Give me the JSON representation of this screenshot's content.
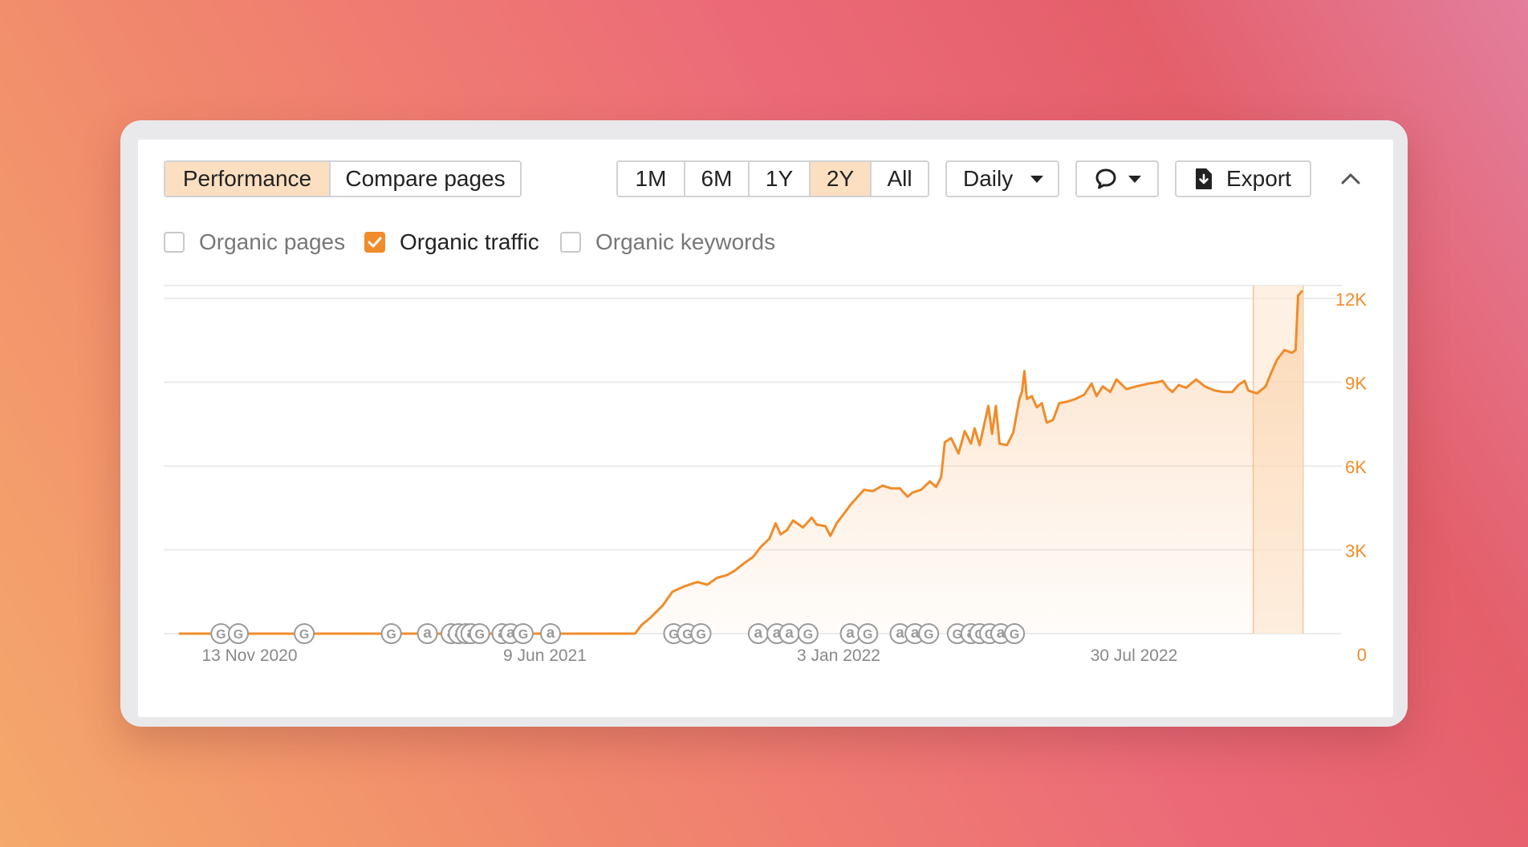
{
  "tabs": [
    {
      "label": "Performance",
      "active": true
    },
    {
      "label": "Compare pages",
      "active": false
    }
  ],
  "ranges": [
    {
      "label": "1M",
      "active": false
    },
    {
      "label": "6M",
      "active": false
    },
    {
      "label": "1Y",
      "active": false
    },
    {
      "label": "2Y",
      "active": true
    },
    {
      "label": "All",
      "active": false
    }
  ],
  "interval": {
    "selected": "Daily"
  },
  "annotations_menu": {
    "icon": "comment-icon"
  },
  "export": {
    "label": "Export",
    "icon": "download-file-icon"
  },
  "collapse": {
    "icon": "chevron-up-icon"
  },
  "metrics": [
    {
      "label": "Organic pages",
      "checked": false
    },
    {
      "label": "Organic traffic",
      "checked": true
    },
    {
      "label": "Organic keywords",
      "checked": false
    }
  ],
  "colors": {
    "accent": "#f08c2a",
    "active_tab": "#fcdfc1",
    "axis_text": "#f08c2a",
    "grid": "#e6e6e6"
  },
  "chart_data": {
    "type": "area",
    "series": [
      {
        "name": "Organic traffic"
      }
    ],
    "x_ticks": [
      "13 Nov 2020",
      "9 Jun 2021",
      "3 Jan 2022",
      "30 Jul 2022"
    ],
    "y_ticks": [
      "0",
      "3K",
      "6K",
      "9K",
      "12K"
    ],
    "ylim": [
      0,
      12000
    ],
    "y_axis_side": "right",
    "grid": true,
    "points": [
      [
        "2020-10-14",
        0
      ],
      [
        "2021-10-15",
        0
      ],
      [
        "2021-10-20",
        300
      ],
      [
        "2021-10-28",
        600
      ],
      [
        "2021-11-06",
        1000
      ],
      [
        "2021-11-14",
        1500
      ],
      [
        "2021-11-24",
        1700
      ],
      [
        "2021-12-04",
        1850
      ],
      [
        "2021-12-12",
        1750
      ],
      [
        "2021-12-20",
        2000
      ],
      [
        "2021-12-28",
        2100
      ],
      [
        "2022-01-03",
        2250
      ],
      [
        "2022-01-10",
        2500
      ],
      [
        "2022-01-18",
        2750
      ],
      [
        "2022-01-24",
        3100
      ],
      [
        "2022-01-31",
        3400
      ],
      [
        "2022-02-05",
        3950
      ],
      [
        "2022-02-09",
        3550
      ],
      [
        "2022-02-14",
        3700
      ],
      [
        "2022-02-19",
        4050
      ],
      [
        "2022-02-27",
        3800
      ],
      [
        "2022-03-06",
        4150
      ],
      [
        "2022-03-10",
        3900
      ],
      [
        "2022-03-17",
        3850
      ],
      [
        "2022-03-21",
        3500
      ],
      [
        "2022-03-26",
        3950
      ],
      [
        "2022-04-01",
        4300
      ],
      [
        "2022-04-06",
        4600
      ],
      [
        "2022-04-12",
        4900
      ],
      [
        "2022-04-17",
        5150
      ],
      [
        "2022-04-24",
        5100
      ],
      [
        "2022-05-02",
        5300
      ],
      [
        "2022-05-09",
        5200
      ],
      [
        "2022-05-16",
        5200
      ],
      [
        "2022-05-22",
        4900
      ],
      [
        "2022-05-26",
        5050
      ],
      [
        "2022-06-02",
        5150
      ],
      [
        "2022-06-09",
        5450
      ],
      [
        "2022-06-14",
        5250
      ],
      [
        "2022-06-18",
        5600
      ],
      [
        "2022-06-21",
        6850
      ],
      [
        "2022-06-26",
        7000
      ],
      [
        "2022-07-02",
        6450
      ],
      [
        "2022-07-07",
        7250
      ],
      [
        "2022-07-12",
        6800
      ],
      [
        "2022-07-15",
        7350
      ],
      [
        "2022-07-19",
        6750
      ],
      [
        "2022-07-23",
        7550
      ],
      [
        "2022-07-26",
        8150
      ],
      [
        "2022-07-29",
        7150
      ],
      [
        "2022-08-01",
        8150
      ],
      [
        "2022-08-04",
        6800
      ],
      [
        "2022-08-10",
        6750
      ],
      [
        "2022-08-15",
        7200
      ],
      [
        "2022-08-20",
        8400
      ],
      [
        "2022-08-22",
        8650
      ],
      [
        "2022-08-24",
        9400
      ],
      [
        "2022-08-26",
        8400
      ],
      [
        "2022-08-30",
        8500
      ],
      [
        "2022-09-03",
        8100
      ],
      [
        "2022-09-07",
        8250
      ],
      [
        "2022-09-11",
        7550
      ],
      [
        "2022-09-16",
        7650
      ],
      [
        "2022-09-21",
        8250
      ],
      [
        "2022-09-27",
        8300
      ],
      [
        "2022-10-04",
        8400
      ],
      [
        "2022-10-11",
        8550
      ],
      [
        "2022-10-17",
        8950
      ],
      [
        "2022-10-21",
        8500
      ],
      [
        "2022-10-26",
        8850
      ],
      [
        "2022-11-01",
        8650
      ],
      [
        "2022-11-06",
        9100
      ],
      [
        "2022-11-14",
        8750
      ],
      [
        "2022-11-22",
        8850
      ],
      [
        "2022-12-02",
        8950
      ],
      [
        "2022-12-09",
        9000
      ],
      [
        "2022-12-13",
        9050
      ],
      [
        "2022-12-17",
        8800
      ],
      [
        "2022-12-21",
        8650
      ],
      [
        "2022-12-26",
        8900
      ],
      [
        "2023-01-01",
        8800
      ],
      [
        "2023-01-09",
        9100
      ],
      [
        "2023-01-16",
        8850
      ],
      [
        "2023-01-24",
        8700
      ],
      [
        "2023-01-31",
        8650
      ],
      [
        "2023-02-07",
        8650
      ],
      [
        "2023-02-12",
        8900
      ],
      [
        "2023-02-17",
        9050
      ],
      [
        "2023-02-20",
        8700
      ],
      [
        "2023-02-27",
        8600
      ],
      [
        "2023-03-06",
        8850
      ],
      [
        "2023-03-10",
        9300
      ],
      [
        "2023-03-15",
        9800
      ],
      [
        "2023-03-21",
        10150
      ],
      [
        "2023-03-27",
        10050
      ],
      [
        "2023-03-30",
        10150
      ],
      [
        "2023-04-01",
        12100
      ],
      [
        "2023-04-04",
        12250
      ]
    ],
    "highlight_range": [
      "2023-02-24",
      "2023-04-05"
    ],
    "events": [
      {
        "date": "2020-11-16",
        "label": "G"
      },
      {
        "date": "2020-11-30",
        "label": "G"
      },
      {
        "date": "2021-01-22",
        "label": "G"
      },
      {
        "date": "2021-04-02",
        "label": "G"
      },
      {
        "date": "2021-05-01",
        "label": "a"
      },
      {
        "date": "2021-05-20",
        "label": "a"
      },
      {
        "date": "2021-05-26",
        "label": "a"
      },
      {
        "date": "2021-06-01",
        "label": "a"
      },
      {
        "date": "2021-06-05",
        "label": "a"
      },
      {
        "date": "2021-06-12",
        "label": "G"
      },
      {
        "date": "2021-06-30",
        "label": "a"
      },
      {
        "date": "2021-07-07",
        "label": "a"
      },
      {
        "date": "2021-07-17",
        "label": "G"
      },
      {
        "date": "2021-08-08",
        "label": "a"
      },
      {
        "date": "2021-11-15",
        "label": "G"
      },
      {
        "date": "2021-11-26",
        "label": "G"
      },
      {
        "date": "2021-12-07",
        "label": "G"
      },
      {
        "date": "2022-01-22",
        "label": "a"
      },
      {
        "date": "2022-02-06",
        "label": "a"
      },
      {
        "date": "2022-02-16",
        "label": "a"
      },
      {
        "date": "2022-03-03",
        "label": "G"
      },
      {
        "date": "2022-04-06",
        "label": "a"
      },
      {
        "date": "2022-04-20",
        "label": "G"
      },
      {
        "date": "2022-05-16",
        "label": "a"
      },
      {
        "date": "2022-05-28",
        "label": "a"
      },
      {
        "date": "2022-06-08",
        "label": "G"
      },
      {
        "date": "2022-07-01",
        "label": "G"
      },
      {
        "date": "2022-07-12",
        "label": "a"
      },
      {
        "date": "2022-07-19",
        "label": "G"
      },
      {
        "date": "2022-07-27",
        "label": "G"
      },
      {
        "date": "2022-08-05",
        "label": "a"
      },
      {
        "date": "2022-08-16",
        "label": "G"
      }
    ]
  }
}
